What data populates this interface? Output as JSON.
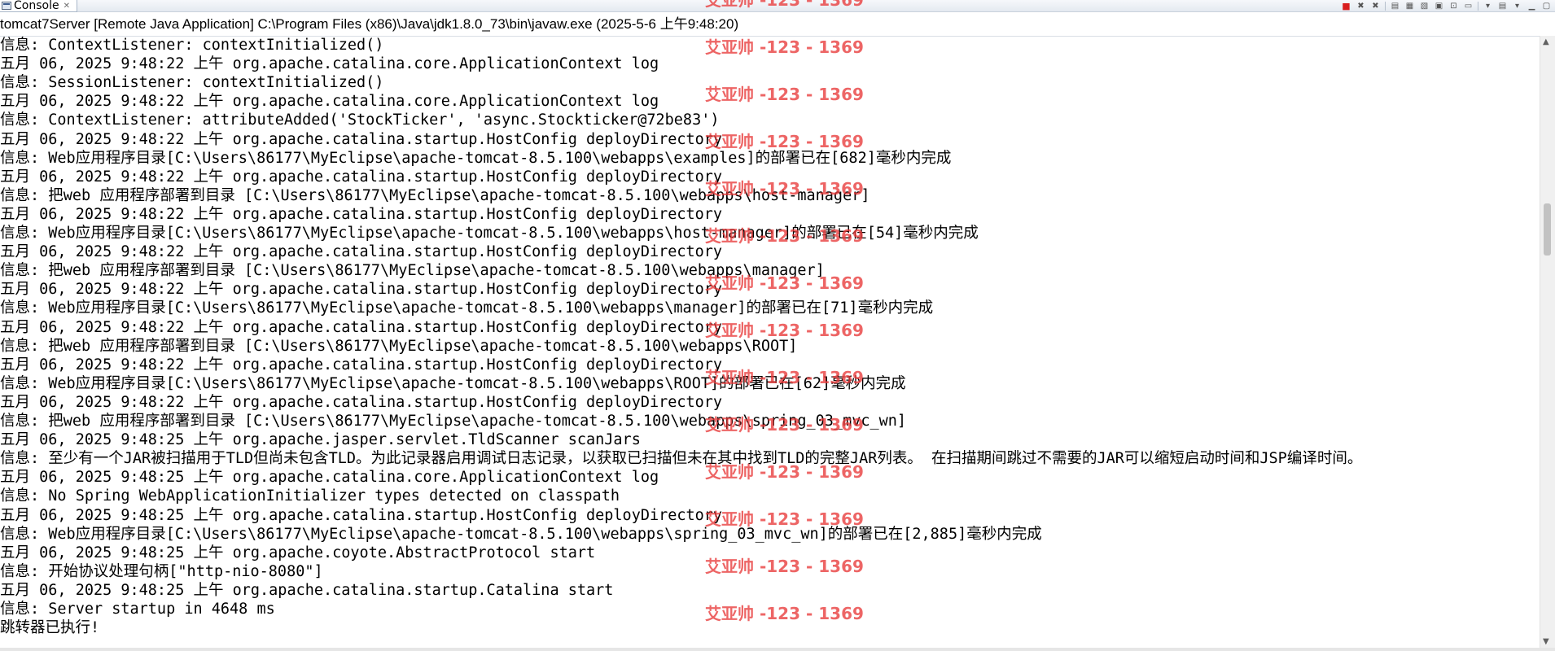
{
  "tab": {
    "label": "Console",
    "close_glyph": "✕",
    "icon": "console-icon"
  },
  "toolbar": {
    "buttons": [
      {
        "icon": "terminate-icon",
        "glyph": "■"
      },
      {
        "icon": "remove-launch-icon",
        "glyph": "✖"
      },
      {
        "icon": "remove-all-terminated-icon",
        "glyph": "✖"
      },
      {
        "icon": "clear-console-icon",
        "glyph": "▤"
      },
      {
        "icon": "scroll-lock-icon",
        "glyph": "▦"
      },
      {
        "icon": "word-wrap-icon",
        "glyph": "▧"
      },
      {
        "icon": "show-on-output-icon",
        "glyph": "▣"
      },
      {
        "icon": "pin-console-icon",
        "glyph": "⊡"
      },
      {
        "icon": "display-console-icon",
        "glyph": "▭"
      },
      {
        "icon": "dropdown-icon",
        "glyph": "▾"
      },
      {
        "icon": "open-console-icon",
        "glyph": "▤"
      },
      {
        "icon": "dropdown-icon",
        "glyph": "▾"
      },
      {
        "icon": "minimize-icon",
        "glyph": "▁"
      },
      {
        "icon": "maximize-icon",
        "glyph": "▢"
      }
    ]
  },
  "process_description": "tomcat7Server [Remote Java Application] C:\\Program Files (x86)\\Java\\jdk1.8.0_73\\bin\\javaw.exe (2025-5-6 上午9:48:20)",
  "watermark_text": "艾亚帅 -123 - 1369",
  "lines": [
    "信息: ContextListener: contextInitialized()",
    "五月 06, 2025 9:48:22 上午 org.apache.catalina.core.ApplicationContext log",
    "信息: SessionListener: contextInitialized()",
    "五月 06, 2025 9:48:22 上午 org.apache.catalina.core.ApplicationContext log",
    "信息: ContextListener: attributeAdded('StockTicker', 'async.Stockticker@72be83')",
    "五月 06, 2025 9:48:22 上午 org.apache.catalina.startup.HostConfig deployDirectory",
    "信息: Web应用程序目录[C:\\Users\\86177\\MyEclipse\\apache-tomcat-8.5.100\\webapps\\examples]的部署已在[682]毫秒内完成",
    "五月 06, 2025 9:48:22 上午 org.apache.catalina.startup.HostConfig deployDirectory",
    "信息: 把web 应用程序部署到目录 [C:\\Users\\86177\\MyEclipse\\apache-tomcat-8.5.100\\webapps\\host-manager]",
    "五月 06, 2025 9:48:22 上午 org.apache.catalina.startup.HostConfig deployDirectory",
    "信息: Web应用程序目录[C:\\Users\\86177\\MyEclipse\\apache-tomcat-8.5.100\\webapps\\host-manager]的部署已在[54]毫秒内完成",
    "五月 06, 2025 9:48:22 上午 org.apache.catalina.startup.HostConfig deployDirectory",
    "信息: 把web 应用程序部署到目录 [C:\\Users\\86177\\MyEclipse\\apache-tomcat-8.5.100\\webapps\\manager]",
    "五月 06, 2025 9:48:22 上午 org.apache.catalina.startup.HostConfig deployDirectory",
    "信息: Web应用程序目录[C:\\Users\\86177\\MyEclipse\\apache-tomcat-8.5.100\\webapps\\manager]的部署已在[71]毫秒内完成",
    "五月 06, 2025 9:48:22 上午 org.apache.catalina.startup.HostConfig deployDirectory",
    "信息: 把web 应用程序部署到目录 [C:\\Users\\86177\\MyEclipse\\apache-tomcat-8.5.100\\webapps\\ROOT]",
    "五月 06, 2025 9:48:22 上午 org.apache.catalina.startup.HostConfig deployDirectory",
    "信息: Web应用程序目录[C:\\Users\\86177\\MyEclipse\\apache-tomcat-8.5.100\\webapps\\ROOT]的部署已在[62]毫秒内完成",
    "五月 06, 2025 9:48:22 上午 org.apache.catalina.startup.HostConfig deployDirectory",
    "信息: 把web 应用程序部署到目录 [C:\\Users\\86177\\MyEclipse\\apache-tomcat-8.5.100\\webapps\\spring_03_mvc_wn]",
    "五月 06, 2025 9:48:25 上午 org.apache.jasper.servlet.TldScanner scanJars",
    "信息: 至少有一个JAR被扫描用于TLD但尚未包含TLD。为此记录器启用调试日志记录，以获取已扫描但未在其中找到TLD的完整JAR列表。 在扫描期间跳过不需要的JAR可以缩短启动时间和JSP编译时间。",
    "五月 06, 2025 9:48:25 上午 org.apache.catalina.core.ApplicationContext log",
    "信息: No Spring WebApplicationInitializer types detected on classpath",
    "五月 06, 2025 9:48:25 上午 org.apache.catalina.startup.HostConfig deployDirectory",
    "信息: Web应用程序目录[C:\\Users\\86177\\MyEclipse\\apache-tomcat-8.5.100\\webapps\\spring_03_mvc_wn]的部署已在[2,885]毫秒内完成",
    "五月 06, 2025 9:48:25 上午 org.apache.coyote.AbstractProtocol start",
    "信息: 开始协议处理句柄[\"http-nio-8080\"]",
    "五月 06, 2025 9:48:25 上午 org.apache.catalina.startup.Catalina start",
    "信息: Server startup in 4648 ms",
    "跳转器已执行!"
  ],
  "colors": {
    "watermark": "#e83a3a",
    "text": "#000000",
    "terminate": "#d81e1e"
  }
}
